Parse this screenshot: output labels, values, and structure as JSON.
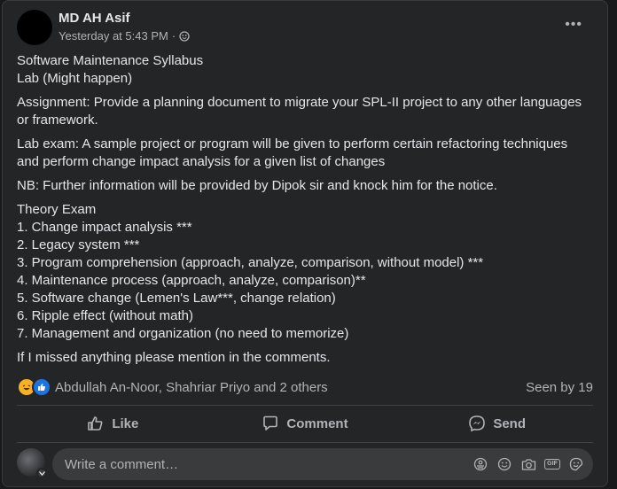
{
  "post": {
    "author": "MD AH Asif",
    "time": "Yesterday at 5:43 PM",
    "separator": "·",
    "more": "•••",
    "paragraphs": [
      [
        "Software Maintenance Syllabus",
        "Lab (Might happen)"
      ],
      [
        "Assignment: Provide a planning document to migrate your SPL-II project to any other languages or framework."
      ],
      [
        "Lab exam: A sample project or program will be given to perform certain refactoring techniques and perform change impact analysis for a given list of changes"
      ],
      [
        "NB: Further information will be provided by Dipok sir and knock him for the notice."
      ],
      [
        "Theory Exam",
        "1. Change impact analysis ***",
        "2. Legacy system ***",
        "3. Program comprehension (approach, analyze, comparison, without model) ***",
        "4. Maintenance process (approach, analyze, comparison)**",
        "5. Software change (Lemen's Law***, change relation)",
        "6. Ripple effect (without math)",
        "7. Management and organization (no need to memorize)"
      ],
      [
        "If I missed anything please mention in the comments."
      ]
    ]
  },
  "reactions": {
    "names": "Abdullah An-Noor, Shahriar Priyo and 2 others",
    "seen": "Seen by 19",
    "icons": [
      "haha-icon",
      "like-icon"
    ]
  },
  "actions": {
    "like": "Like",
    "comment": "Comment",
    "send": "Send"
  },
  "comment": {
    "placeholder": "Write a comment…"
  },
  "colors": {
    "background": "#18191a",
    "card": "#242526",
    "text": "#e4e6eb",
    "secondary": "#b0b3b8",
    "like_blue": "#1b74e4",
    "haha_yellow": "#f7b125"
  }
}
